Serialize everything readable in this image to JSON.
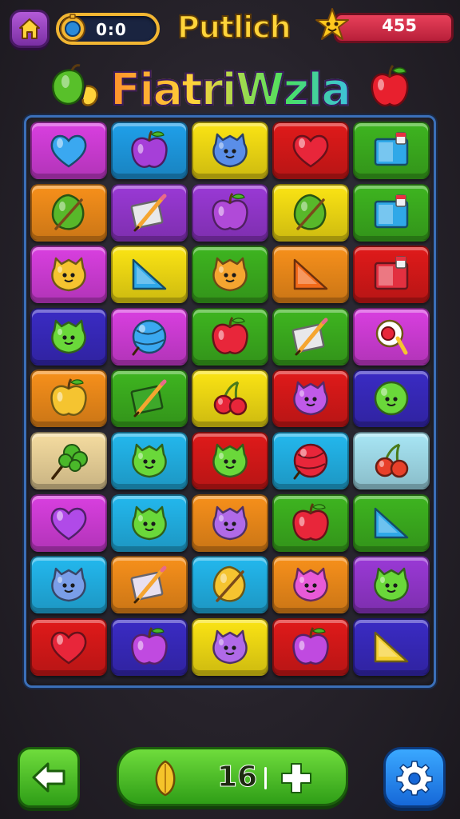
{
  "hud": {
    "timer": "0:0",
    "game_name": "Putlich",
    "score": "455"
  },
  "title": "FiatriWzla",
  "footer": {
    "moves": "16"
  },
  "colors": {
    "magenta": "#d93fe0",
    "blue": "#1fa0ea",
    "yellow": "#fbe414",
    "red": "#e01a1a",
    "green": "#3eb520",
    "orange": "#f7901b",
    "purple": "#9a39d6",
    "navy": "#3a2bc4",
    "cyan": "#23b8ee",
    "cream": "#f5dca0",
    "lightblue": "#a8e6f5",
    "accent_gold": "#ffd43a",
    "score_red": "#e8405a"
  },
  "board": {
    "rows": 9,
    "cols": 5,
    "tiles": [
      [
        {
          "bg": "magenta",
          "icon": "heart-icon",
          "c": "#3aa8f0"
        },
        {
          "bg": "blue",
          "icon": "apple-icon",
          "c": "#a63fd8"
        },
        {
          "bg": "yellow",
          "icon": "monster-icon",
          "c": "#5a8ee8"
        },
        {
          "bg": "red",
          "icon": "heart-icon",
          "c": "#e8263a"
        },
        {
          "bg": "green",
          "icon": "box-icon",
          "c": "#2fa8e8"
        }
      ],
      [
        {
          "bg": "orange",
          "icon": "leaf-icon",
          "c": "#58b82a"
        },
        {
          "bg": "purple",
          "icon": "pencil-icon",
          "c": "#e8e8ea"
        },
        {
          "bg": "purple",
          "icon": "apple-icon",
          "c": "#b04ad8"
        },
        {
          "bg": "yellow",
          "icon": "leaf-icon",
          "c": "#58b82a"
        },
        {
          "bg": "green",
          "icon": "box-icon",
          "c": "#2fa8e8"
        }
      ],
      [
        {
          "bg": "magenta",
          "icon": "monster-icon",
          "c": "#f5c430"
        },
        {
          "bg": "yellow",
          "icon": "triangle-icon",
          "c": "#2fa8e8"
        },
        {
          "bg": "green",
          "icon": "monster-icon",
          "c": "#f5a530"
        },
        {
          "bg": "orange",
          "icon": "triangle-icon",
          "c": "#f26a1a"
        },
        {
          "bg": "red",
          "icon": "box-icon",
          "c": "#e23040"
        }
      ],
      [
        {
          "bg": "navy",
          "icon": "monster-icon",
          "c": "#6ad83a"
        },
        {
          "bg": "magenta",
          "icon": "ball-icon",
          "c": "#3aa8f0"
        },
        {
          "bg": "green",
          "icon": "apple-icon",
          "c": "#e8263a"
        },
        {
          "bg": "green",
          "icon": "pencil-icon",
          "c": "#e8e8ea"
        },
        {
          "bg": "magenta",
          "icon": "pin-icon",
          "c": "#f5c430"
        }
      ],
      [
        {
          "bg": "orange",
          "icon": "apple-icon",
          "c": "#f5c430"
        },
        {
          "bg": "green",
          "icon": "pencil-icon",
          "c": "#3ea82a"
        },
        {
          "bg": "yellow",
          "icon": "cherry-icon",
          "c": "#e8263a"
        },
        {
          "bg": "red",
          "icon": "monster-icon",
          "c": "#c05ae8"
        },
        {
          "bg": "navy",
          "icon": "smiley-icon",
          "c": "#6ad83a"
        }
      ],
      [
        {
          "bg": "cream",
          "icon": "flower-icon",
          "c": "#4ab82a"
        },
        {
          "bg": "cyan",
          "icon": "monster-icon",
          "c": "#6ad83a"
        },
        {
          "bg": "red",
          "icon": "monster-icon",
          "c": "#6ad83a"
        },
        {
          "bg": "cyan",
          "icon": "ball-icon",
          "c": "#e8263a"
        },
        {
          "bg": "lightblue",
          "icon": "cherry-icon",
          "c": "#e8402a"
        }
      ],
      [
        {
          "bg": "magenta",
          "icon": "heart-icon",
          "c": "#b04ae8"
        },
        {
          "bg": "cyan",
          "icon": "monster-icon",
          "c": "#6ad83a"
        },
        {
          "bg": "orange",
          "icon": "monster-icon",
          "c": "#b06ae8"
        },
        {
          "bg": "green",
          "icon": "apple-icon",
          "c": "#e8263a"
        },
        {
          "bg": "green",
          "icon": "triangle-icon",
          "c": "#2fa8e8"
        }
      ],
      [
        {
          "bg": "cyan",
          "icon": "monster-icon",
          "c": "#7a9ee8"
        },
        {
          "bg": "orange",
          "icon": "pencil-icon",
          "c": "#e8e0f0"
        },
        {
          "bg": "cyan",
          "icon": "leaf-icon",
          "c": "#f5c430"
        },
        {
          "bg": "orange",
          "icon": "monster-icon",
          "c": "#e85ad8"
        },
        {
          "bg": "purple",
          "icon": "monster-icon",
          "c": "#6ad83a"
        }
      ],
      [
        {
          "bg": "red",
          "icon": "heart-icon",
          "c": "#e8263a"
        },
        {
          "bg": "navy",
          "icon": "apple-icon",
          "c": "#c04ae0"
        },
        {
          "bg": "yellow",
          "icon": "monster-icon",
          "c": "#b06ae8"
        },
        {
          "bg": "red",
          "icon": "apple-icon",
          "c": "#c04ae0"
        },
        {
          "bg": "navy",
          "icon": "triangle-icon",
          "c": "#f5d030"
        }
      ]
    ]
  }
}
